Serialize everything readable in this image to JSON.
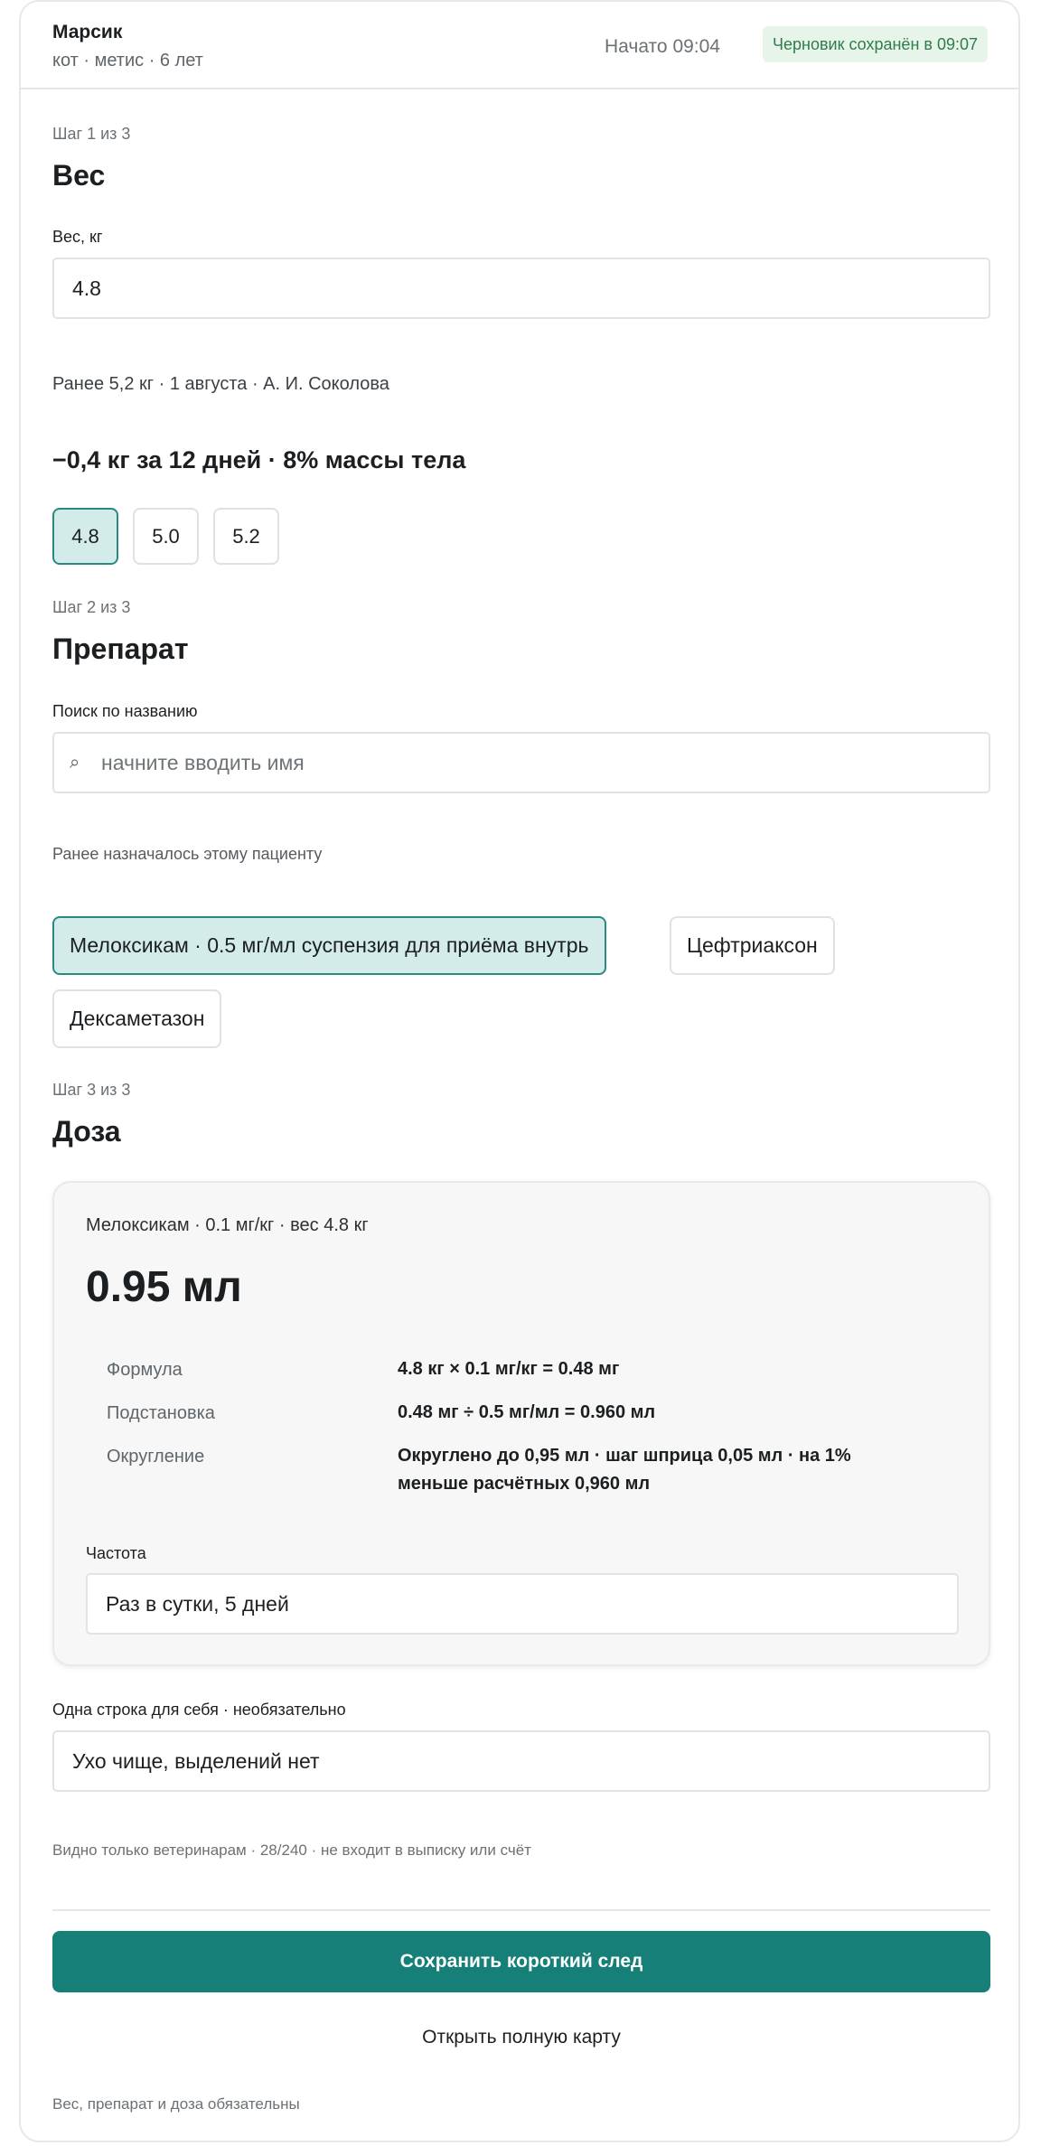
{
  "patient": {
    "name": "Марсик",
    "meta": "кот · метис · 6 лет",
    "started": "Начато 09:04",
    "draft_status": "Черновик сохранён в 09:07"
  },
  "steps": {
    "weight": {
      "step_label": "Шаг 1 из 3",
      "title": "Вес",
      "field_label": "Вес, кг",
      "value": "4.8",
      "previous": "Ранее 5,2 кг · 1 августа · А. И. Соколова",
      "delta": "−0,4 кг за 12 дней · 8% массы тела",
      "chips": [
        {
          "label": "4.8",
          "selected": true
        },
        {
          "label": "5.0",
          "selected": false
        },
        {
          "label": "5.2",
          "selected": false
        }
      ]
    },
    "drug": {
      "step_label": "Шаг 2 из 3",
      "title": "Препарат",
      "search_label": "Поиск по названию",
      "search_icon": "search-icon",
      "search_placeholder": "начните вводить имя",
      "history_label": "Ранее назначалось этому пациенту",
      "chips": [
        {
          "label": "Мелоксикам · 0.5 мг/мл суспензия для приёма внутрь",
          "selected": true
        },
        {
          "label": "Цефтриаксон",
          "selected": false
        },
        {
          "label": "Дексаметазон",
          "selected": false
        }
      ]
    },
    "dose": {
      "step_label": "Шаг 3 из 3",
      "title": "Доза",
      "summary": "Мелоксикам · 0.1 мг/кг · вес 4.8 кг",
      "value": "0.95 мл",
      "rows": [
        {
          "label": "Формула",
          "value": "4.8 кг × 0.1 мг/кг = 0.48 мг"
        },
        {
          "label": "Подстановка",
          "value": "0.48 мг ÷ 0.5 мг/мл = 0.960 мл"
        },
        {
          "label": "Округление",
          "value": "Округлено до 0,95 мл · шаг шприца 0,05 мл · на 1% меньше расчётных 0,960 мл"
        }
      ],
      "frequency_label": "Частота",
      "frequency_value": "Раз в сутки, 5 дней"
    }
  },
  "note": {
    "label": "Одна строка для себя · необязательно",
    "value": "Ухо чище, выделений нет",
    "hint": "Видно только ветеринарам · 28/240 · не входит в выписку или счёт"
  },
  "actions": {
    "save": "Сохранить короткий след",
    "open_card": "Открыть полную карту",
    "footnote": "Вес, препарат и доза обязательны"
  },
  "colors": {
    "primary": "#157f78",
    "chip_selected_bg": "#d3ecea",
    "draft_badge_bg": "#e6f4ea",
    "draft_badge_text": "#2e7d4a"
  }
}
